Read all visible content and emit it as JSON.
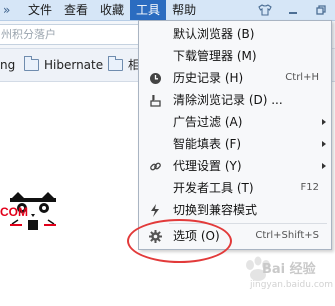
{
  "menubar": {
    "items": [
      {
        "label": "文件",
        "active": false
      },
      {
        "label": "查看",
        "active": false
      },
      {
        "label": "收藏",
        "active": false
      },
      {
        "label": "工具",
        "active": true
      },
      {
        "label": "帮助",
        "active": false
      }
    ]
  },
  "address_bar": {
    "value": "州积分落户"
  },
  "bookmarks": {
    "items": [
      {
        "label": "ng"
      },
      {
        "label": "Hibernate"
      },
      {
        "label": "相"
      }
    ]
  },
  "tools_menu": {
    "items": [
      {
        "label": "默认浏览器 (B)",
        "shortcut": "",
        "submenu": false,
        "icon": ""
      },
      {
        "label": "下载管理器 (M)",
        "shortcut": "",
        "submenu": false,
        "icon": ""
      },
      {
        "label": "历史记录 (H)",
        "shortcut": "Ctrl+H",
        "submenu": false,
        "icon": "clock-icon"
      },
      {
        "label": "清除浏览记录 (D) ...",
        "shortcut": "",
        "submenu": false,
        "icon": "clear-history-icon"
      },
      {
        "label": "广告过滤 (A)",
        "shortcut": "",
        "submenu": true,
        "icon": ""
      },
      {
        "label": "智能填表 (F)",
        "shortcut": "",
        "submenu": true,
        "icon": ""
      },
      {
        "label": "代理设置 (Y)",
        "shortcut": "",
        "submenu": true,
        "icon": "link-icon"
      },
      {
        "label": "开发者工具 (T)",
        "shortcut": "F12",
        "submenu": false,
        "icon": ""
      },
      {
        "label": "切换到兼容模式",
        "shortcut": "",
        "submenu": false,
        "icon": "lightning-icon"
      },
      {
        "label": "选项 (O)",
        "shortcut": "Ctrl+Shift+S",
        "submenu": false,
        "icon": "gear-icon"
      }
    ]
  },
  "page": {
    "logo_text": "COM"
  },
  "watermark": {
    "text": "Bai 经验",
    "sub": "jingyan.baidu.com"
  },
  "colors": {
    "accent": "#2b6cc0",
    "annotation": "#e23a3a",
    "logo": "#e2001a"
  }
}
